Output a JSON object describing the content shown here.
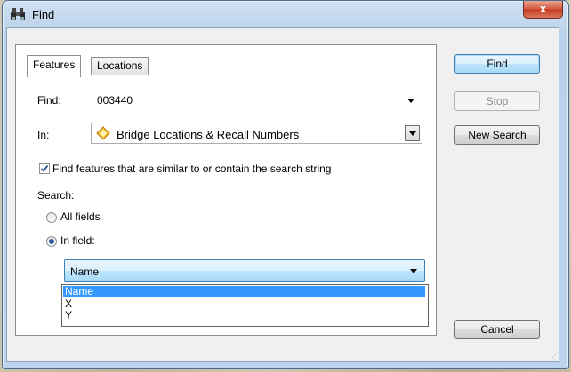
{
  "window": {
    "title": "Find",
    "close_symbol": "x"
  },
  "tabs": [
    {
      "label": "Features",
      "active": true
    },
    {
      "label": "Locations",
      "active": false
    }
  ],
  "form": {
    "find_label": "Find:",
    "find_value": "003440",
    "in_label": "In:",
    "in_value": "Bridge Locations & Recall Numbers",
    "in_icon": "layer-diamond-icon",
    "similar_checkbox_label": "Find features that are similar to or contain the search string",
    "similar_checked": true,
    "search_label": "Search:",
    "all_fields_label": "All fields",
    "in_field_label": "In field:",
    "in_field_selected": true,
    "field_value": "Name",
    "field_options": [
      "Name",
      "X",
      "Y"
    ]
  },
  "buttons": {
    "find": "Find",
    "stop": "Stop",
    "new_search": "New Search",
    "cancel": "Cancel"
  },
  "icons": {
    "title": "binoculars-icon",
    "close": "close-icon"
  },
  "colors": {
    "selection": "#3399ff",
    "accent_border": "#3c7fb1"
  }
}
